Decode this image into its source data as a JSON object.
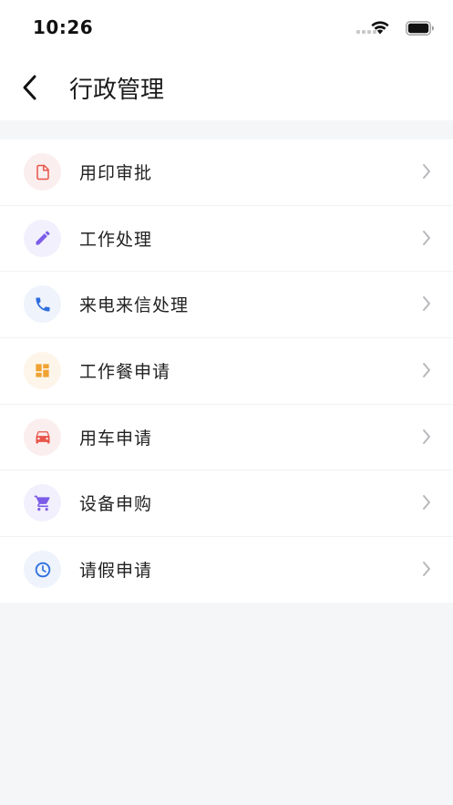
{
  "status_bar": {
    "time": "10:26"
  },
  "header": {
    "title": "行政管理"
  },
  "menu": {
    "items": [
      {
        "label": "用印审批",
        "icon": "document-icon",
        "color": "#e8554a",
        "bg": "#fbeeee"
      },
      {
        "label": "工作处理",
        "icon": "pencil-icon",
        "color": "#7b5ce8",
        "bg": "#f3f0fd"
      },
      {
        "label": "来电来信处理",
        "icon": "phone-icon",
        "color": "#2f6fde",
        "bg": "#eef3fc"
      },
      {
        "label": "工作餐申请",
        "icon": "dashboard-icon",
        "color": "#f0a232",
        "bg": "#fdf5ea"
      },
      {
        "label": "用车申请",
        "icon": "car-icon",
        "color": "#e8554a",
        "bg": "#fbeeee"
      },
      {
        "label": "设备申购",
        "icon": "cart-icon",
        "color": "#7b5ce8",
        "bg": "#f3f0fd"
      },
      {
        "label": "请假申请",
        "icon": "clock-icon",
        "color": "#2f6fde",
        "bg": "#eef3fc"
      }
    ]
  },
  "colors": {
    "page_bg": "#f5f6f8",
    "card_bg": "#ffffff",
    "chevron": "#b8b8bc"
  }
}
